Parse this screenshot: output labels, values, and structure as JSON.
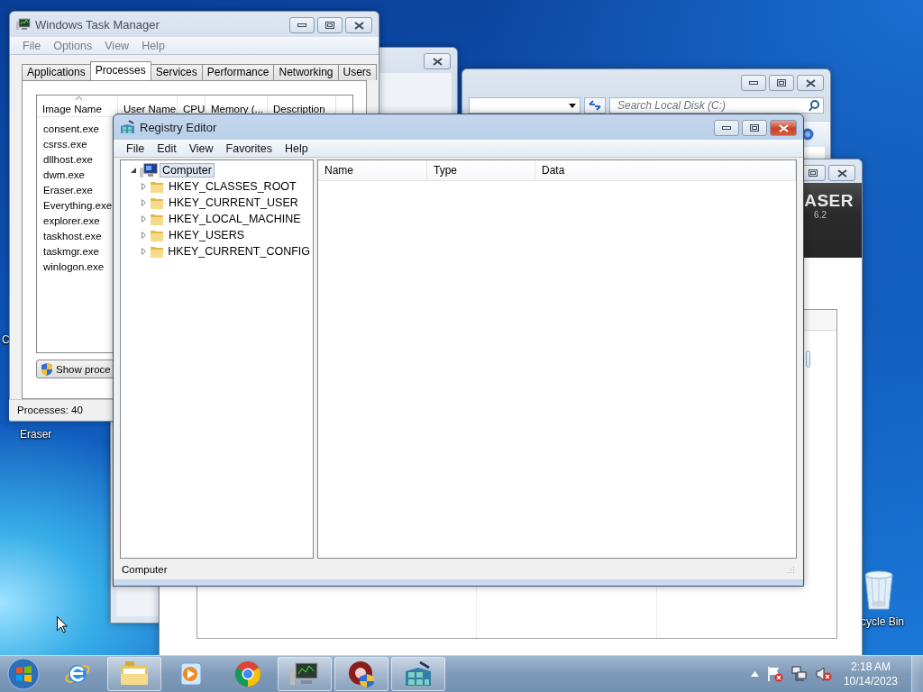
{
  "desktop_icons": [
    {
      "kind": "label_only",
      "label": "C"
    },
    {
      "kind": "label_only",
      "label": "Eraser"
    },
    {
      "kind": "recycle_bin",
      "label": "cycle Bin"
    }
  ],
  "background_dialog": {
    "active": false
  },
  "explorer": {
    "active": false,
    "search": {
      "placeholder": "Search Local Disk (C:)"
    }
  },
  "eraser": {
    "active": false,
    "logo": "ASER",
    "version": "6.2"
  },
  "task_manager": {
    "title": "Windows Task Manager",
    "active": false,
    "menu": [
      "File",
      "Options",
      "View",
      "Help"
    ],
    "tabs": [
      {
        "label": "Applications",
        "selected": false
      },
      {
        "label": "Processes",
        "selected": true
      },
      {
        "label": "Services",
        "selected": false
      },
      {
        "label": "Performance",
        "selected": false
      },
      {
        "label": "Networking",
        "selected": false
      },
      {
        "label": "Users",
        "selected": false
      }
    ],
    "columns": [
      {
        "label": "Image Name",
        "sorted": true
      },
      {
        "label": "User Name",
        "sorted": false
      },
      {
        "label": "CPU",
        "sorted": false
      },
      {
        "label": "Memory (...",
        "sorted": false
      },
      {
        "label": "Description",
        "sorted": false
      }
    ],
    "rows": [
      "consent.exe",
      "csrss.exe",
      "dllhost.exe",
      "dwm.exe",
      "Eraser.exe",
      "Everything.exe",
      "explorer.exe",
      "taskhost.exe",
      "taskmgr.exe",
      "winlogon.exe"
    ],
    "button": "Show proce",
    "status": "Processes: 40"
  },
  "registry_editor": {
    "title": "Registry Editor",
    "active": true,
    "menu": [
      "File",
      "Edit",
      "View",
      "Favorites",
      "Help"
    ],
    "tree": [
      {
        "label": "Computer",
        "selected": true,
        "expanded": true,
        "children": [
          {
            "label": "HKEY_CLASSES_ROOT",
            "selected": false,
            "expanded": false
          },
          {
            "label": "HKEY_CURRENT_USER",
            "selected": false,
            "expanded": false
          },
          {
            "label": "HKEY_LOCAL_MACHINE",
            "selected": false,
            "expanded": false
          },
          {
            "label": "HKEY_USERS",
            "selected": false,
            "expanded": false
          },
          {
            "label": "HKEY_CURRENT_CONFIG",
            "selected": false,
            "expanded": false
          }
        ]
      }
    ],
    "columns": [
      "Name",
      "Type",
      "Data"
    ],
    "status": "Computer"
  },
  "taskbar": {
    "items": [
      {
        "kind": "ie",
        "running": false
      },
      {
        "kind": "explorer",
        "running": true
      },
      {
        "kind": "media_player",
        "running": false
      },
      {
        "kind": "chrome",
        "running": false
      },
      {
        "kind": "task_manager",
        "running": true
      },
      {
        "kind": "eraser",
        "running": true
      },
      {
        "kind": "registry",
        "running": true
      }
    ],
    "time": "2:18 AM",
    "date": "10/14/2023"
  }
}
